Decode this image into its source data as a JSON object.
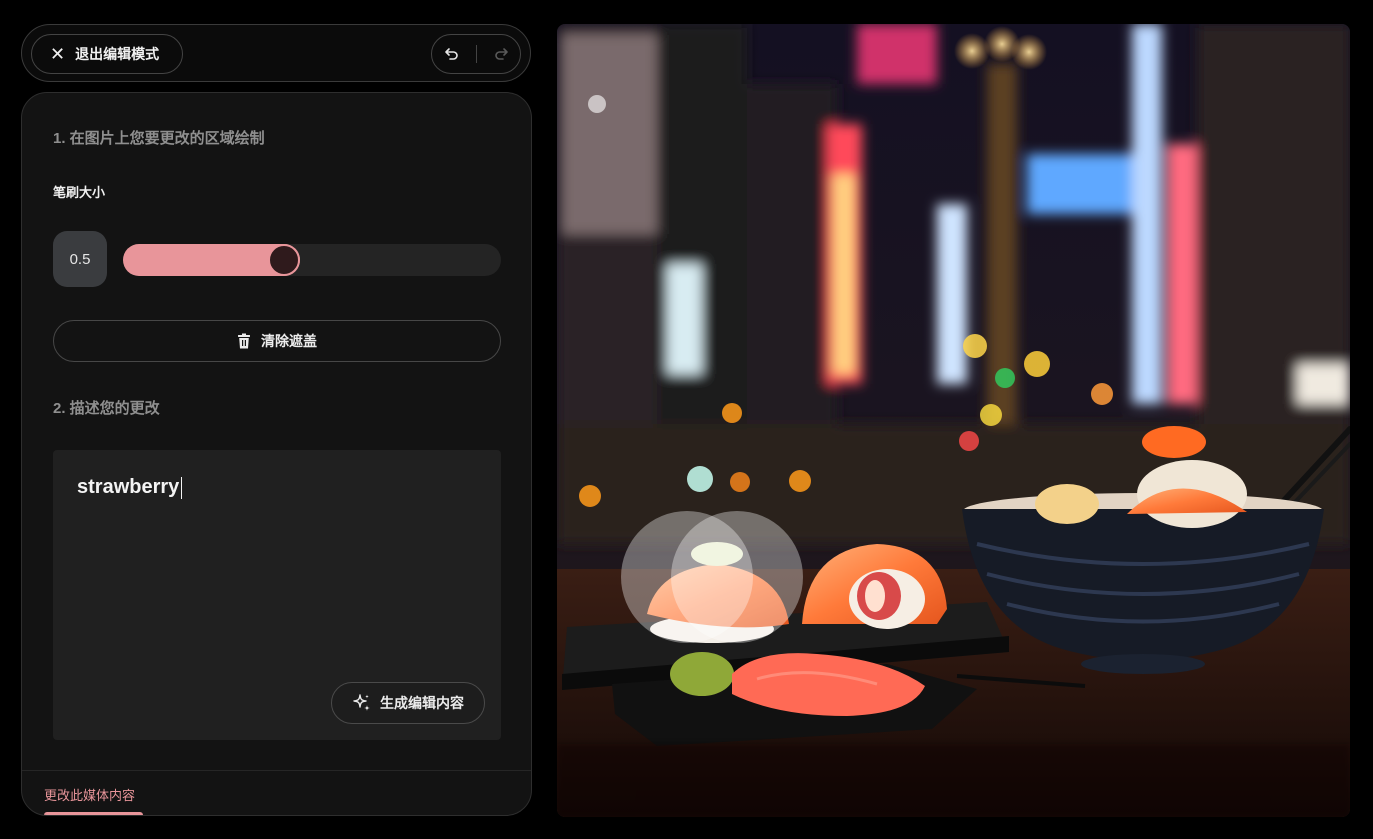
{
  "toolbar": {
    "exit_label": "退出编辑模式",
    "exit_icon": "close-icon",
    "undo_icon": "undo-icon",
    "redo_icon": "redo-icon"
  },
  "panel": {
    "step1_title": "1. 在图片上您要更改的区域绘制",
    "brush_label": "笔刷大小",
    "brush_value": "0.5",
    "brush_level": 0.42,
    "clear_label": "清除遮盖",
    "clear_icon": "trash-icon",
    "step2_title": "2. 描述您的更改",
    "prompt_value": "strawberry",
    "generate_label": "生成编辑内容",
    "generate_icon": "sparkle-icon",
    "footer_tab": "更改此媒体内容"
  },
  "colors": {
    "accent": "#e8959a",
    "background": "#000000",
    "panel": "#131313"
  }
}
